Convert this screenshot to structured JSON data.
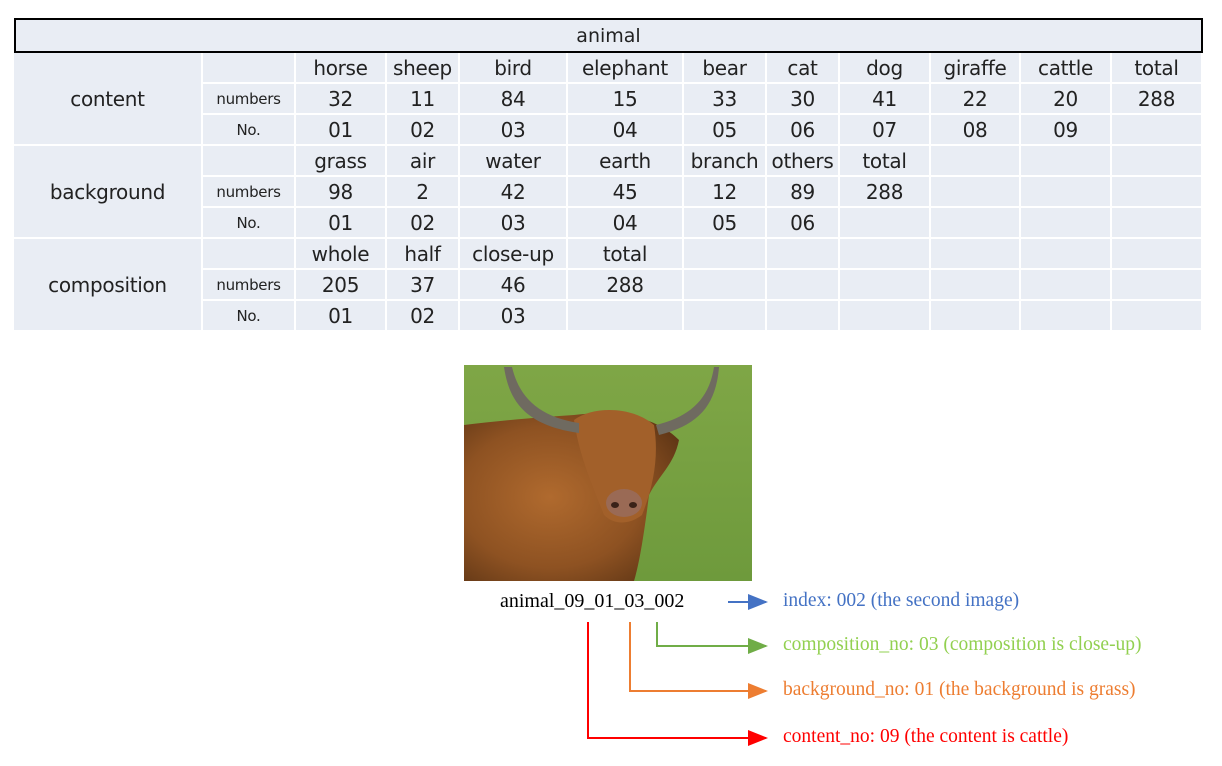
{
  "table": {
    "title": "animal",
    "groups": [
      {
        "name": "content",
        "header": [
          "",
          "horse",
          "sheep",
          "bird",
          "elephant",
          "bear",
          "cat",
          "dog",
          "giraffe",
          "cattle",
          "total"
        ],
        "numbers": [
          "numbers",
          "32",
          "11",
          "84",
          "15",
          "33",
          "30",
          "41",
          "22",
          "20",
          "288"
        ],
        "no": [
          "No.",
          "01",
          "02",
          "03",
          "04",
          "05",
          "06",
          "07",
          "08",
          "09",
          ""
        ]
      },
      {
        "name": "background",
        "header": [
          "",
          "grass",
          "air",
          "water",
          "earth",
          "branch",
          "others",
          "total",
          "",
          "",
          ""
        ],
        "numbers": [
          "numbers",
          "98",
          "2",
          "42",
          "45",
          "12",
          "89",
          "288",
          "",
          "",
          ""
        ],
        "no": [
          "No.",
          "01",
          "02",
          "03",
          "04",
          "05",
          "06",
          "",
          "",
          "",
          ""
        ]
      },
      {
        "name": "composition",
        "header": [
          "",
          "whole",
          "half",
          "close-up",
          "total",
          "",
          "",
          "",
          "",
          "",
          ""
        ],
        "numbers": [
          "numbers",
          "205",
          "37",
          "46",
          "288",
          "",
          "",
          "",
          "",
          "",
          ""
        ],
        "no": [
          "No.",
          "01",
          "02",
          "03",
          "",
          "",
          "",
          "",
          "",
          "",
          ""
        ]
      }
    ]
  },
  "example": {
    "image_alt": "Highland cattle on grass, close-up",
    "filename": "animal_09_01_03_002",
    "annotations": {
      "index": "index: 002 (the second image)",
      "composition": "composition_no: 03 (composition is close-up)",
      "background": "background_no: 01 (the background is grass)",
      "content": "content_no: 09 (the content is cattle)"
    },
    "colors": {
      "index": "#4472c4",
      "composition": "#92d050",
      "background": "#ed7d31",
      "content": "#ff0000"
    }
  }
}
